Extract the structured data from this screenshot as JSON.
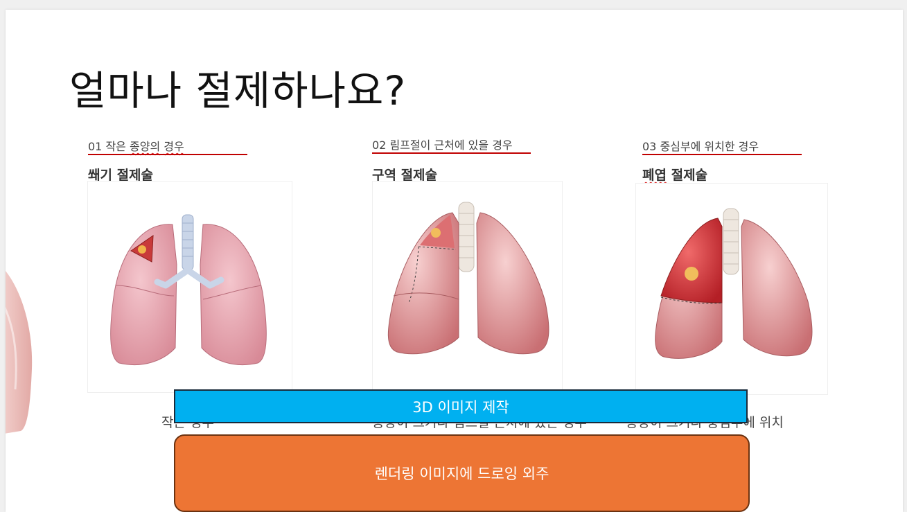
{
  "slide": {
    "title": "얼마나 절제하나요?"
  },
  "columns": [
    {
      "number": "01",
      "subtitle_prefix": "작은",
      "subtitle_squiggle": "종양의",
      "subtitle_suffix": "경우",
      "heading": "쐐기 절제술",
      "caption": "작은 경우",
      "image_icon": "lung-wedge-resection-illustration"
    },
    {
      "number": "02",
      "subtitle": "림프절이 근처에 있을 경우",
      "heading": "구역 절제술",
      "caption": "종양이 크거나 림프절 근처에 있는 경우",
      "image_icon": "lung-segmentectomy-illustration"
    },
    {
      "number": "03",
      "subtitle": "중심부에 위치한 경우",
      "heading_prefix": "폐엽",
      "heading_suffix": "절제술",
      "caption": "종양이 크거나 중심부에 위치",
      "image_icon": "lung-lobectomy-illustration"
    }
  ],
  "buttons": {
    "make_3d": "3D 이미지 제작",
    "outsource": "렌더링 이미지에 드로잉 외주"
  },
  "colors": {
    "accent_red": "#c00000",
    "button_blue": "#00b0f0",
    "button_orange": "#ed7534"
  }
}
